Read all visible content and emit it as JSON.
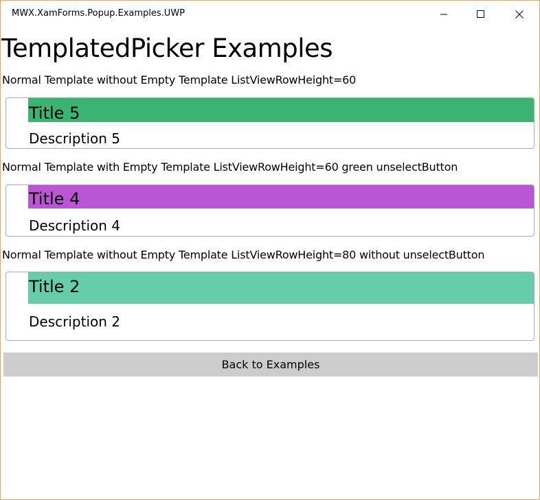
{
  "window": {
    "title": "MWX.XamForms.Popup.Examples.UWP"
  },
  "page": {
    "title": "TemplatedPicker Examples"
  },
  "sections": [
    {
      "label": "Normal Template without Empty Template ListViewRowHeight=60",
      "selected_title": "Title 5",
      "selected_description": "Description 5",
      "color": "#3cb371"
    },
    {
      "label": "Normal Template with Empty Template ListViewRowHeight=60 green unselectButton",
      "selected_title": "Title 4",
      "selected_description": "Description 4",
      "color": "#ba55d3"
    },
    {
      "label": "Normal Template without Empty Template ListViewRowHeight=80 without unselectButton",
      "selected_title": "Title 2",
      "selected_description": "Description 2",
      "color": "#66cdaa"
    }
  ],
  "back_button": {
    "label": "Back to Examples"
  },
  "icons": {
    "minimize": "minimize-icon",
    "maximize": "maximize-icon",
    "close": "close-icon"
  }
}
